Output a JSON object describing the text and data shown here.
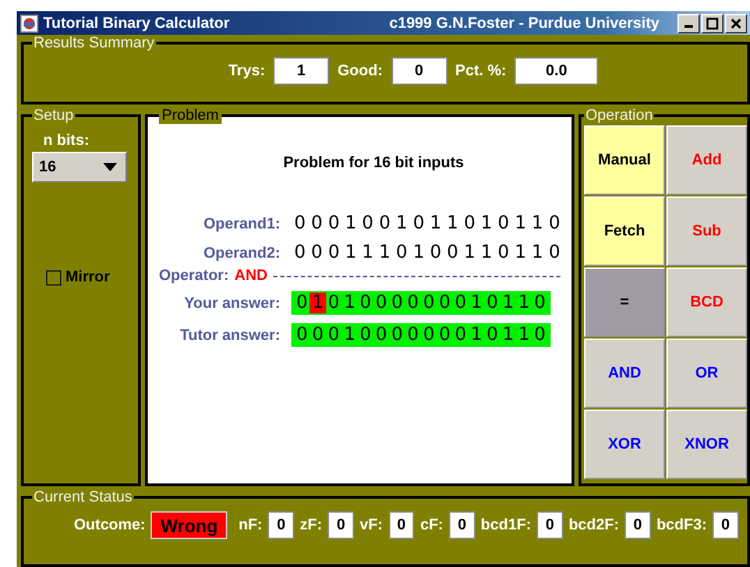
{
  "window": {
    "title": "Tutorial Binary Calculator",
    "credit": "c1999 G.N.Foster - Purdue University"
  },
  "results_summary": {
    "title": "Results Summary",
    "fields": [
      {
        "label": "Trys:",
        "value": "1"
      },
      {
        "label": "Good:",
        "value": "0"
      },
      {
        "label": "Pct. %:",
        "value": "0.0"
      }
    ]
  },
  "setup": {
    "title": "Setup",
    "n_bits_label": "n bits:",
    "n_bits": "16",
    "mirror": {
      "label": "Mirror",
      "checked": false
    }
  },
  "problem": {
    "title": "Problem",
    "heading": "Problem for 16 bit inputs",
    "operands": [
      {
        "label": "Operand1:",
        "bits": "0001001011010110"
      },
      {
        "label": "Operand2:",
        "bits": "0001110100110110"
      }
    ],
    "operator_label": "Operator:",
    "operator": "AND",
    "answers": [
      {
        "label": "Your answer:",
        "bits": [
          {
            "bit": "0",
            "wrong": false
          },
          {
            "bit": "1",
            "wrong": true
          },
          {
            "bit": "0",
            "wrong": false
          },
          {
            "bit": "1",
            "wrong": false
          },
          {
            "bit": "0",
            "wrong": false
          },
          {
            "bit": "0",
            "wrong": false
          },
          {
            "bit": "0",
            "wrong": false
          },
          {
            "bit": "0",
            "wrong": false
          },
          {
            "bit": "0",
            "wrong": false
          },
          {
            "bit": "0",
            "wrong": false
          },
          {
            "bit": "0",
            "wrong": false
          },
          {
            "bit": "1",
            "wrong": false
          },
          {
            "bit": "0",
            "wrong": false
          },
          {
            "bit": "1",
            "wrong": false
          },
          {
            "bit": "1",
            "wrong": false
          },
          {
            "bit": "0",
            "wrong": false
          }
        ]
      },
      {
        "label": "Tutor answer:",
        "bits": [
          {
            "bit": "0",
            "wrong": false
          },
          {
            "bit": "0",
            "wrong": false
          },
          {
            "bit": "0",
            "wrong": false
          },
          {
            "bit": "1",
            "wrong": false
          },
          {
            "bit": "0",
            "wrong": false
          },
          {
            "bit": "0",
            "wrong": false
          },
          {
            "bit": "0",
            "wrong": false
          },
          {
            "bit": "0",
            "wrong": false
          },
          {
            "bit": "0",
            "wrong": false
          },
          {
            "bit": "0",
            "wrong": false
          },
          {
            "bit": "0",
            "wrong": false
          },
          {
            "bit": "1",
            "wrong": false
          },
          {
            "bit": "0",
            "wrong": false
          },
          {
            "bit": "1",
            "wrong": false
          },
          {
            "bit": "1",
            "wrong": false
          },
          {
            "bit": "0",
            "wrong": false
          }
        ]
      }
    ]
  },
  "operation": {
    "title": "Operation",
    "buttons": [
      {
        "label": "Manual",
        "kind": "mode"
      },
      {
        "label": "Add",
        "kind": "arith"
      },
      {
        "label": "Fetch",
        "kind": "mode"
      },
      {
        "label": "Sub",
        "kind": "arith"
      },
      {
        "label": "=",
        "kind": "equals"
      },
      {
        "label": "BCD",
        "kind": "arith"
      },
      {
        "label": "AND",
        "kind": "logic"
      },
      {
        "label": "OR",
        "kind": "logic"
      },
      {
        "label": "XOR",
        "kind": "logic"
      },
      {
        "label": "XNOR",
        "kind": "logic"
      }
    ]
  },
  "current_status": {
    "title": "Current Status",
    "outcome_label": "Outcome:",
    "outcome": "Wrong",
    "flags": [
      {
        "label": "nF:",
        "value": "0"
      },
      {
        "label": "zF:",
        "value": "0"
      },
      {
        "label": "vF:",
        "value": "0"
      },
      {
        "label": "cF:",
        "value": "0"
      },
      {
        "label": "bcd1F:",
        "value": "0"
      },
      {
        "label": "bcd2F:",
        "value": "0"
      },
      {
        "label": "bcdF3:",
        "value": "0"
      }
    ]
  }
}
